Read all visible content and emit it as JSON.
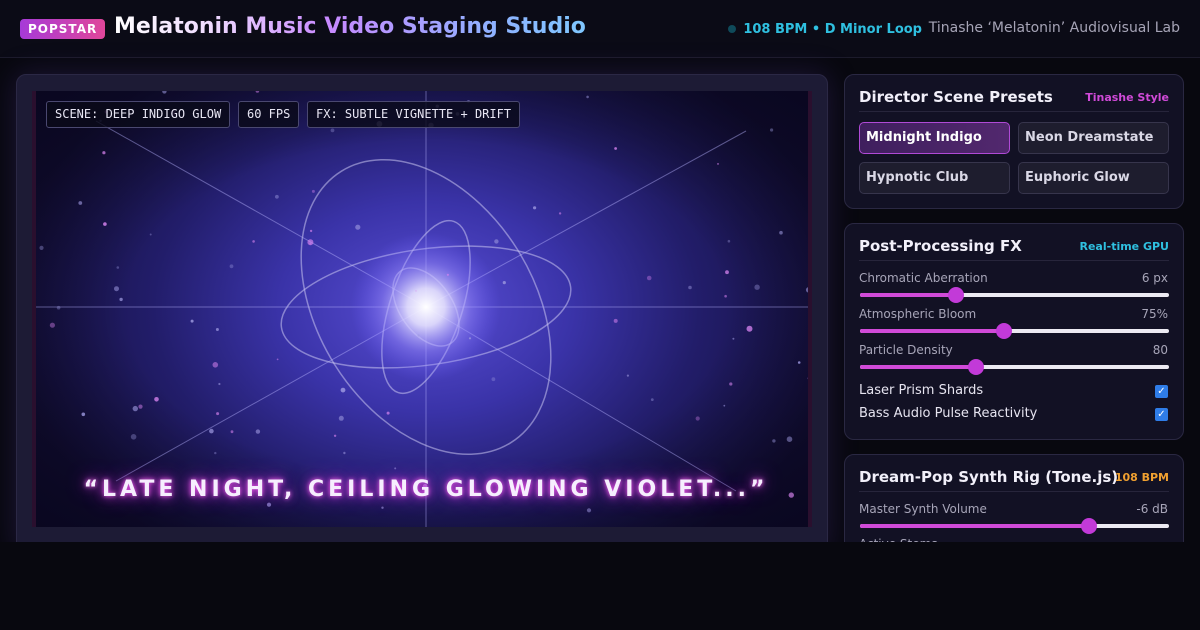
{
  "header": {
    "badge": "POPSTAR",
    "title": "Melatonin Music Video Staging Studio",
    "bpm_status": "108 BPM • D Minor Loop",
    "lab_name": "Tinashe ‘Melatonin’ Audiovisual Lab"
  },
  "stage": {
    "tags": [
      "SCENE: DEEP INDIGO GLOW",
      "60 FPS",
      "FX: SUBTLE VIGNETTE + DRIFT"
    ],
    "lyric": "“LATE NIGHT, CEILING GLOWING VIOLET...”"
  },
  "presets": {
    "title": "Director Scene Presets",
    "tag": "Tinashe Style",
    "items": [
      {
        "label": "Midnight Indigo",
        "active": true
      },
      {
        "label": "Neon Dreamstate",
        "active": false
      },
      {
        "label": "Hypnotic Club",
        "active": false
      },
      {
        "label": "Euphoric Glow",
        "active": false
      }
    ]
  },
  "fx": {
    "title": "Post-Processing FX",
    "tag": "Real-time GPU",
    "sliders": [
      {
        "label": "Chromatic Aberration",
        "value": "6 px",
        "fraction": 0.31
      },
      {
        "label": "Atmospheric Bloom",
        "value": "75%",
        "fraction": 0.465
      },
      {
        "label": "Particle Density",
        "value": "80",
        "fraction": 0.375
      }
    ],
    "toggles": [
      {
        "label": "Laser Prism Shards",
        "checked": true
      },
      {
        "label": "Bass Audio Pulse Reactivity",
        "checked": true
      }
    ]
  },
  "synth": {
    "title": "Dream-Pop Synth Rig (Tone.js)",
    "tag": "108 BPM",
    "master_label": "Master Synth Volume",
    "master_value": "-6 dB",
    "master_fraction": 0.74,
    "next_label": "Active Stems"
  },
  "colors": {
    "accent": "#d04ad8",
    "cyan": "#2fc0e0",
    "orange": "#f0a030",
    "brand_gradient": [
      "#a63ad8",
      "#e0469a"
    ]
  }
}
